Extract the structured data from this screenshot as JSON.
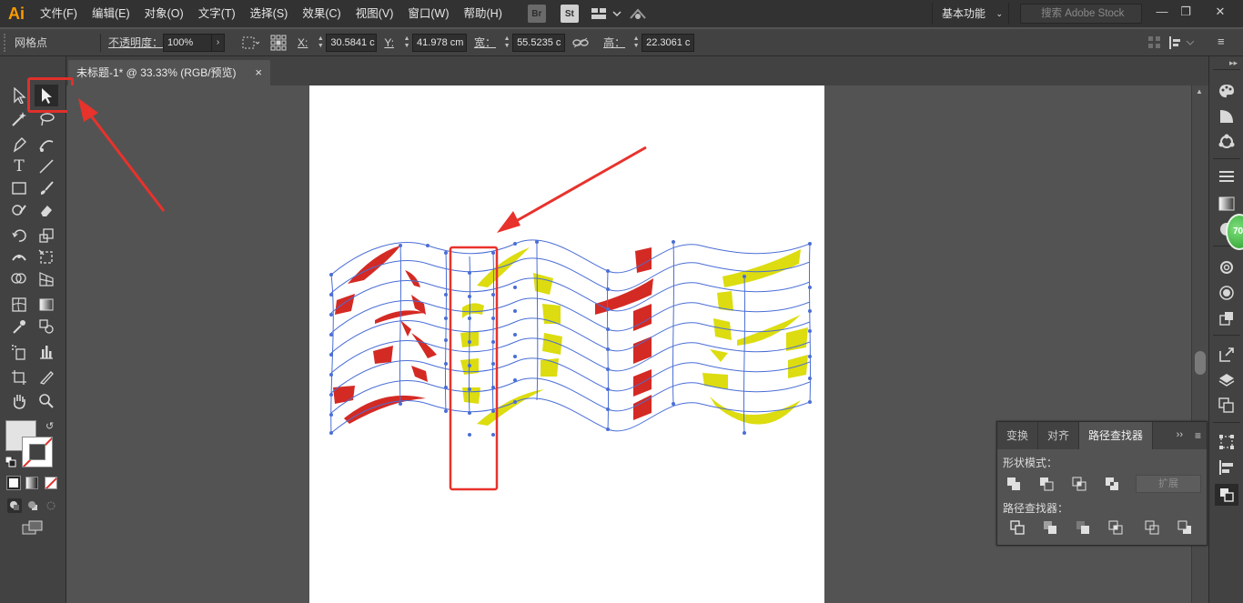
{
  "menubar": {
    "logo": "Ai",
    "items": [
      "文件(F)",
      "编辑(E)",
      "对象(O)",
      "文字(T)",
      "选择(S)",
      "效果(C)",
      "视图(V)",
      "窗口(W)",
      "帮助(H)"
    ],
    "bridge_label": "Br",
    "stock_label": "St",
    "workspace_label": "基本功能",
    "search_placeholder": "搜索 Adobe Stock",
    "window_buttons": [
      "—",
      "❐",
      "✕"
    ]
  },
  "control_bar": {
    "selection_label": "网格点",
    "opacity_label": "不透明度：",
    "opacity_value": "100%",
    "x_label": "X:",
    "x_value": "30.5841 c",
    "y_label": "Y:",
    "y_value": "41.978 cm",
    "w_label": "宽：",
    "w_value": "55.5235 c",
    "h_label": "高：",
    "h_value": "22.3061 c"
  },
  "document": {
    "tab_title": "未标题-1* @ 33.33% (RGB/预览)",
    "tab_close": "×"
  },
  "toolbox": {
    "collapse_label": "◂◂",
    "active_tool": "direct-selection-tool",
    "highlight_color": "#e0302a"
  },
  "artwork": {
    "red_color": "#d42a24",
    "yellow_color": "#dcdc10",
    "grid_color": "#4a6ed6",
    "annotation_color": "#e8322c"
  },
  "dock": {
    "collapse_label": "▸▸",
    "notification_badge": "70"
  },
  "pathfinder_panel": {
    "tabs": [
      "变换",
      "对齐",
      "路径查找器"
    ],
    "active_tab": "路径查找器",
    "more_label": "››",
    "menu_label": "≡",
    "shape_modes_label": "形状模式：",
    "pathfinders_label": "路径查找器：",
    "expand_label": "扩展"
  }
}
